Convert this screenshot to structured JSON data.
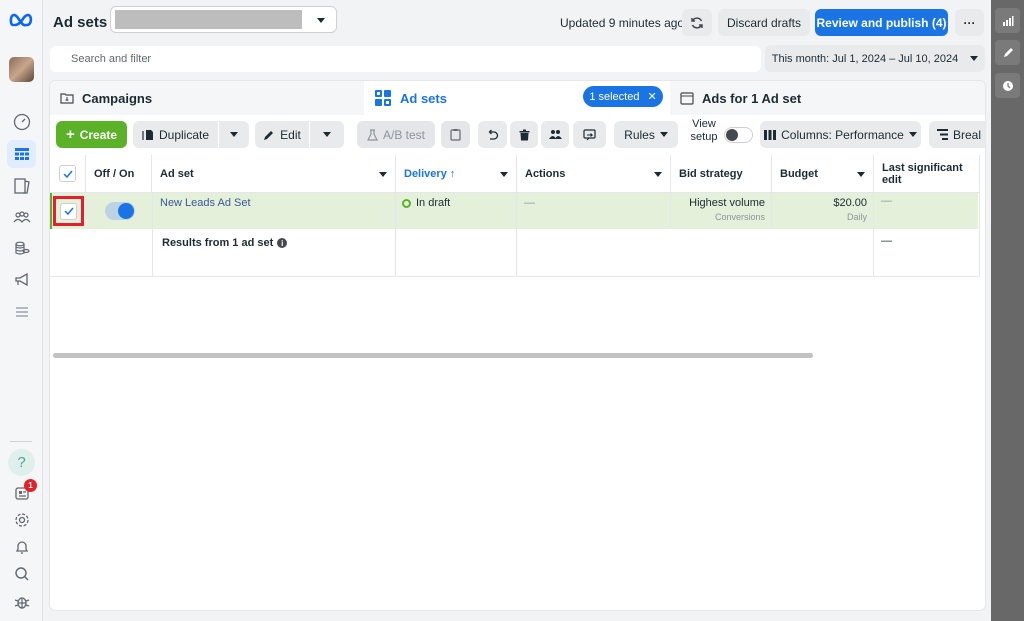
{
  "header": {
    "title": "Ad sets",
    "updated": "Updated 9 minutes ago",
    "discard_label": "Discard drafts",
    "publish_label": "Review and publish (4)",
    "more_label": "···"
  },
  "search": {
    "placeholder": "Search and filter"
  },
  "date_range": "This month: Jul 1, 2024 – Jul 10, 2024",
  "tabs": {
    "campaigns": "Campaigns",
    "adsets": "Ad sets",
    "selected_pill": "1 selected",
    "ads": "Ads for 1 Ad set"
  },
  "toolbar": {
    "create": "Create",
    "duplicate": "Duplicate",
    "edit": "Edit",
    "ab_test": "A/B test",
    "rules": "Rules",
    "view_setup": "View setup",
    "columns": "Columns: Performance",
    "breakdown": "Breal"
  },
  "table": {
    "headers": {
      "offon": "Off / On",
      "adset": "Ad set",
      "delivery": "Delivery ↑",
      "actions": "Actions",
      "bid": "Bid strategy",
      "budget": "Budget",
      "last_edit": "Last significant edit"
    },
    "row": {
      "name": "New Leads Ad Set",
      "delivery": "In draft",
      "actions": "—",
      "bid": "Highest volume",
      "bid_sub": "Conversions",
      "budget": "$20.00",
      "budget_sub": "Daily",
      "last_edit": "—",
      "toggle_on": true,
      "checked": true
    },
    "summary": {
      "label": "Results from 1 ad set",
      "last_edit": "—"
    }
  },
  "nav": {
    "notification_count": "1",
    "help": "?"
  },
  "colors": {
    "brand": "#1b74e4",
    "create": "#5bb229",
    "row_selected": "#e4f0d9",
    "highlight": "#e4202a"
  }
}
